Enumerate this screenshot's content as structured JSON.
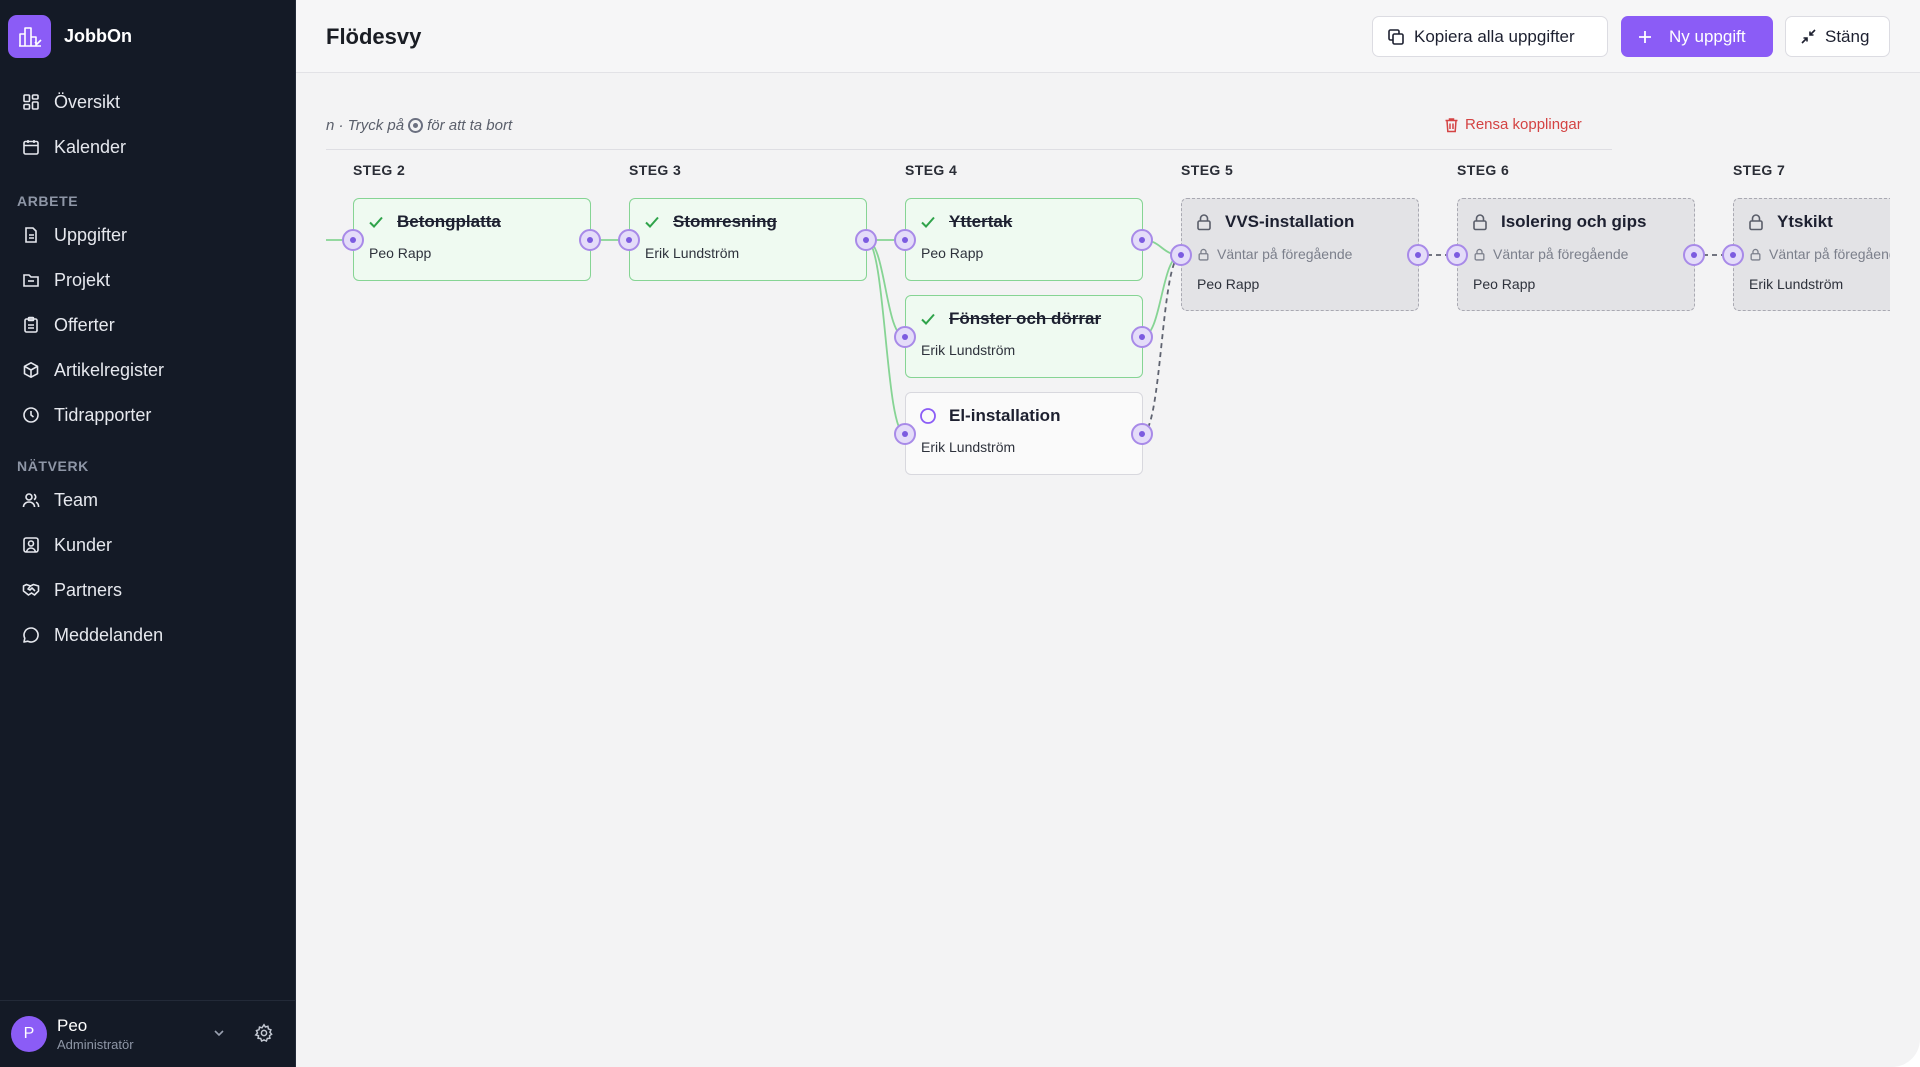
{
  "app": {
    "name": "JobbOn"
  },
  "sidebar": {
    "main_items": [
      {
        "label": "Översikt",
        "icon": "grid-icon"
      },
      {
        "label": "Kalender",
        "icon": "calendar-icon"
      }
    ],
    "work_heading": "ARBETE",
    "work_items": [
      {
        "label": "Uppgifter",
        "icon": "document-icon"
      },
      {
        "label": "Projekt",
        "icon": "folder-icon"
      },
      {
        "label": "Offerter",
        "icon": "clipboard-icon"
      },
      {
        "label": "Artikelregister",
        "icon": "box-icon"
      },
      {
        "label": "Tidrapporter",
        "icon": "clock-icon"
      }
    ],
    "network_heading": "NÄTVERK",
    "network_items": [
      {
        "label": "Team",
        "icon": "users-icon"
      },
      {
        "label": "Kunder",
        "icon": "contact-icon"
      },
      {
        "label": "Partners",
        "icon": "handshake-icon"
      },
      {
        "label": "Meddelanden",
        "icon": "message-icon"
      }
    ],
    "user": {
      "initial": "P",
      "name": "Peo",
      "role": "Administratör"
    }
  },
  "header": {
    "title": "Flödesvy",
    "copy_label": "Kopiera alla uppgifter",
    "new_label": "Ny uppgift",
    "close_label": "Stäng"
  },
  "flow": {
    "hint_before": "n · Tryck på",
    "hint_after": "för att ta bort",
    "clear_label": "Rensa kopplingar",
    "steps": [
      "STEG 2",
      "STEG 3",
      "STEG 4",
      "STEG 5",
      "STEG 6",
      "STEG 7"
    ],
    "tasks": [
      {
        "title": "Betongplatta",
        "assignee": "Peo Rapp",
        "status": "done"
      },
      {
        "title": "Stomresning",
        "assignee": "Erik Lundström",
        "status": "done"
      },
      {
        "title": "Yttertak",
        "assignee": "Peo Rapp",
        "status": "done"
      },
      {
        "title": "Fönster och dörrar",
        "assignee": "Erik Lundström",
        "status": "done"
      },
      {
        "title": "El-installation",
        "assignee": "Erik Lundström",
        "status": "open"
      },
      {
        "title": "VVS-installation",
        "assignee": "Peo Rapp",
        "status": "locked",
        "waiting": "Väntar på föregående"
      },
      {
        "title": "Isolering och gips",
        "assignee": "Peo Rapp",
        "status": "locked",
        "waiting": "Väntar på föregående"
      },
      {
        "title": "Ytskikt",
        "assignee": "Erik Lundström",
        "status": "locked",
        "waiting": "Väntar på föregående"
      }
    ]
  },
  "colors": {
    "accent": "#8b5cf6",
    "done_border": "#86d494",
    "done_bg": "#effaf1",
    "danger": "#d44343",
    "sidebar_bg": "#141a26"
  }
}
